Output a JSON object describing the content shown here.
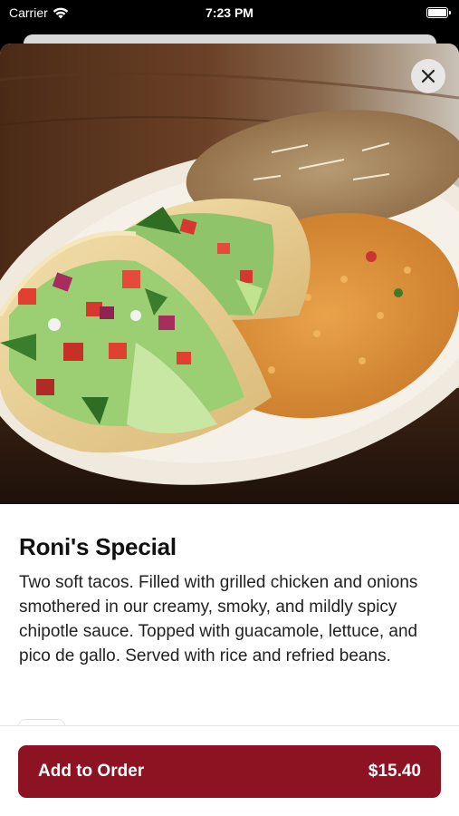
{
  "status_bar": {
    "carrier": "Carrier",
    "time": "7:23 PM"
  },
  "item": {
    "name": "Roni's Special",
    "description": "Two soft tacos. Filled with grilled chicken and onions smothered in our creamy, smoky, and mildly spicy chipotle sauce. Topped with guacamole, lettuce, and pico de gallo. Served with rice and refried beans."
  },
  "footer": {
    "add_label": "Add to Order",
    "price": "$15.40"
  },
  "colors": {
    "accent": "#8e1322"
  },
  "icons": {
    "close": "close-icon",
    "wifi": "wifi-icon",
    "battery": "battery-icon"
  }
}
